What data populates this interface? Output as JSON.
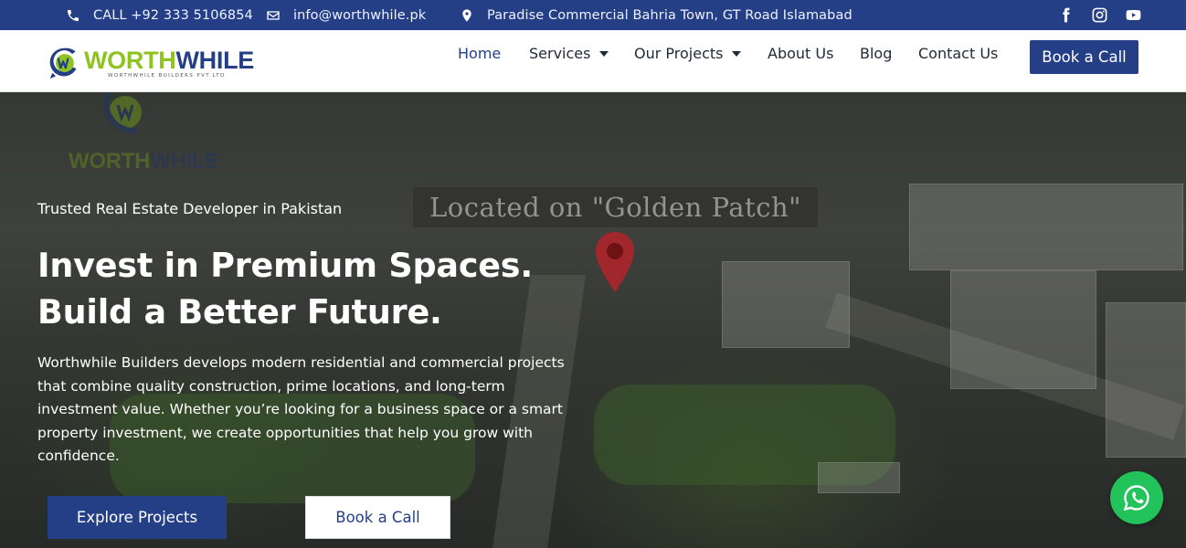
{
  "topbar": {
    "phone": "CALL +92 333 5106854",
    "email": "info@worthwhile.pk",
    "address": "Paradise Commercial Bahria Town, GT Road Islamabad",
    "social_icons": [
      "facebook-icon",
      "instagram-icon",
      "youtube-icon"
    ]
  },
  "header": {
    "logo": {
      "word1": "WORTH",
      "word2": "WHILE",
      "subtitle": "WORTHWHILE BUILDERS PVT.LTD"
    },
    "nav": [
      {
        "label": "Home",
        "active": true
      },
      {
        "label": "Services",
        "dropdown": true
      },
      {
        "label": "Our Projects",
        "dropdown": true
      },
      {
        "label": "About Us"
      },
      {
        "label": "Blog"
      },
      {
        "label": "Contact Us"
      }
    ],
    "cta_label": "Book a Call"
  },
  "hero": {
    "watermark_text": "Located on \"Golden Patch\"",
    "tagline": "Trusted Real Estate Developer in Pakistan",
    "headline": "Invest in Premium Spaces. Build a Better Future.",
    "description": "Worthwhile Builders develops modern residential and commercial projects that combine quality construction, prime locations, and long-term investment value. Whether you’re looking for a business space or a smart property investment, we create opportunities that help you grow with confidence.",
    "primary_button": "Explore Projects",
    "secondary_button": "Book a Call"
  },
  "colors": {
    "brand_blue": "#253f86",
    "brand_green": "#8fc31f",
    "whatsapp_green": "#22c35a"
  }
}
